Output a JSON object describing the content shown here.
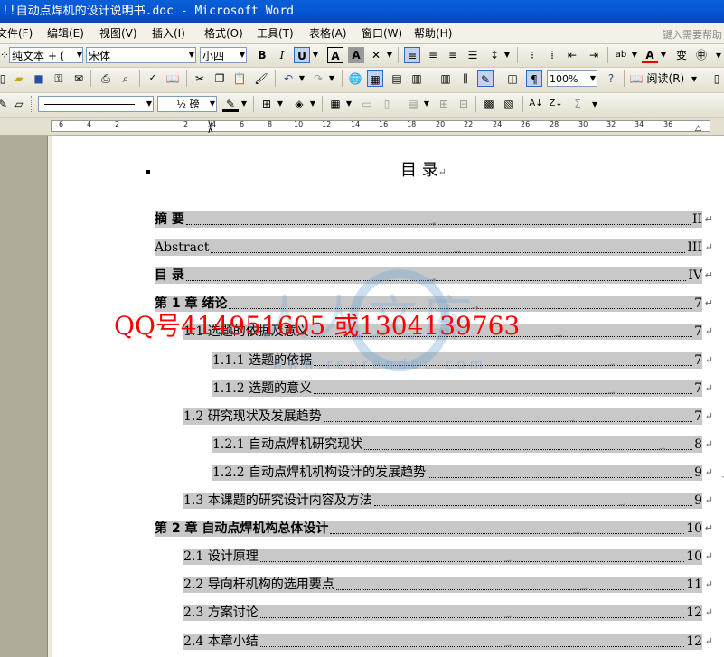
{
  "window": {
    "title": "!!自动点焊机的设计说明书.doc - Microsoft Word"
  },
  "menu": {
    "items": [
      "文件(F)",
      "编辑(E)",
      "视图(V)",
      "插入(I)",
      "格式(O)",
      "工具(T)",
      "表格(A)",
      "窗口(W)",
      "帮助(H)"
    ],
    "help_search": "键入需要帮助"
  },
  "format_toolbar": {
    "style": "纯文本 + (",
    "font": "宋体",
    "size": "小四",
    "bold": "B",
    "italic": "I",
    "underline": "U",
    "char_border": "A",
    "char_shading": "A",
    "font_color": "A",
    "phonetic": "变"
  },
  "standard_toolbar": {
    "zoom": "100%",
    "read_mode": "阅读(R)"
  },
  "tables_toolbar": {
    "line_weight": "½ 磅"
  },
  "ruler": {
    "labels": [
      "6",
      "4",
      "2",
      "2",
      "4",
      "6",
      "8",
      "10",
      "12",
      "14",
      "16",
      "18",
      "20",
      "22",
      "24",
      "26",
      "28",
      "30",
      "32",
      "34",
      "36"
    ]
  },
  "document": {
    "title": "目  录",
    "watermark": {
      "text": "人人文库",
      "url": "www.renrendoc.com"
    },
    "overlay": "QQ号414951605  或1304139763",
    "toc": [
      {
        "text": "摘  要",
        "page": "II",
        "level": 0,
        "bold": true
      },
      {
        "text": "Abstract",
        "page": "III",
        "level": 0,
        "bold": false
      },
      {
        "text": "目  录",
        "page": "IV",
        "level": 0,
        "bold": true
      },
      {
        "text": "第 1 章  绪论",
        "page": "7",
        "level": 0,
        "bold": true
      },
      {
        "text": "1.1  选题的依据及意义",
        "page": "7",
        "level": 1,
        "bold": false
      },
      {
        "text": "1.1.1  选题的依据",
        "page": "7",
        "level": 2,
        "bold": false
      },
      {
        "text": "1.1.2  选题的意义",
        "page": "7",
        "level": 2,
        "bold": false
      },
      {
        "text": "1.2  研究现状及发展趋势",
        "page": "7",
        "level": 1,
        "bold": false
      },
      {
        "text": "1.2.1  自动点焊机研究现状",
        "page": "8",
        "level": 2,
        "bold": false
      },
      {
        "text": "1.2.2  自动点焊机机构设计的发展趋势",
        "page": "9",
        "level": 2,
        "bold": false
      },
      {
        "text": "1.3  本课题的研究设计内容及方法",
        "page": "9",
        "level": 1,
        "bold": false
      },
      {
        "text": "第 2 章  自动点焊机构总体设计",
        "page": "10",
        "level": 0,
        "bold": true
      },
      {
        "text": "2.1  设计原理",
        "page": "10",
        "level": 1,
        "bold": false
      },
      {
        "text": "2.2  导向杆机构的选用要点",
        "page": "11",
        "level": 1,
        "bold": false
      },
      {
        "text": "2.3  方案讨论",
        "page": "12",
        "level": 1,
        "bold": false
      },
      {
        "text": "2.4  本章小结",
        "page": "12",
        "level": 1,
        "bold": false
      }
    ]
  }
}
